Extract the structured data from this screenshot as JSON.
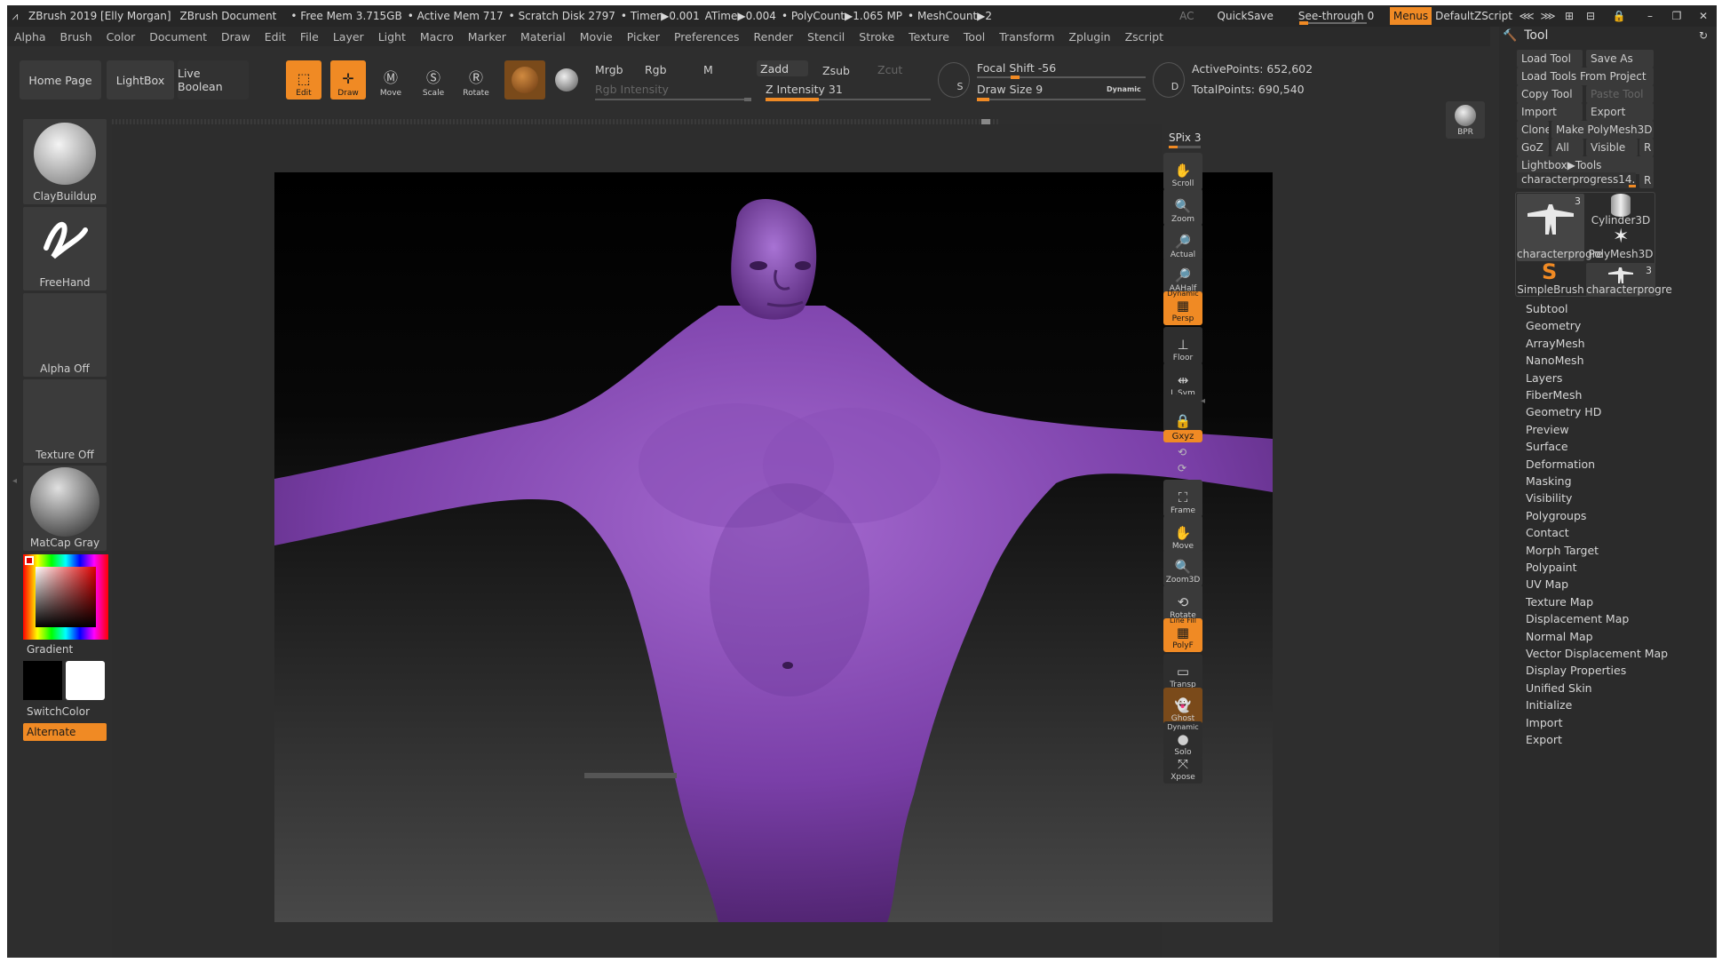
{
  "titlebar": {
    "title": "ZBrush 2019 [Elly Morgan]",
    "doc": "ZBrush Document",
    "free_mem": "• Free Mem 3.715GB",
    "active_mem": "• Active Mem 717",
    "scratch": "• Scratch Disk 2797",
    "timer": "• Timer▶0.001",
    "atime": "ATime▶0.004",
    "polycount": "• PolyCount▶1.065 MP",
    "meshcount": "• MeshCount▶2",
    "ac": "AC",
    "quicksave": "QuickSave",
    "seethrough": "See-through",
    "seethrough_value": "0",
    "menus": "Menus",
    "script": "DefaultZScript"
  },
  "menubar": [
    "Alpha",
    "Brush",
    "Color",
    "Document",
    "Draw",
    "Edit",
    "File",
    "Layer",
    "Light",
    "Macro",
    "Marker",
    "Material",
    "Movie",
    "Picker",
    "Preferences",
    "Render",
    "Stencil",
    "Stroke",
    "Texture",
    "Tool",
    "Transform",
    "Zplugin",
    "Zscript"
  ],
  "toolbar": {
    "home": "Home Page",
    "lightbox": "LightBox",
    "liveboolean": "Live Boolean",
    "edit": "Edit",
    "draw": "Draw",
    "move": "Move",
    "scale": "Scale",
    "rotate": "Rotate",
    "mrgb": "Mrgb",
    "rgb": "Rgb",
    "m": "M",
    "zadd": "Zadd",
    "zsub": "Zsub",
    "zcut": "Zcut",
    "rgb_intensity": "Rgb Intensity",
    "z_intensity": "Z Intensity 31",
    "z_intensity_value": 31,
    "focal_shift": "Focal Shift -56",
    "focal_shift_value": -56,
    "draw_size": "Draw Size 9",
    "draw_size_value": 9,
    "dynamic": "Dynamic",
    "active_points": "ActivePoints: 652,602",
    "total_points": "TotalPoints: 690,540",
    "s_label": "S",
    "d_label": "D"
  },
  "leftshelf": {
    "brush": "ClayBuildup",
    "stroke": "FreeHand",
    "alpha": "Alpha Off",
    "texture": "Texture Off",
    "material": "MatCap Gray",
    "gradient": "Gradient",
    "switchcolor": "SwitchColor",
    "alternate": "Alternate"
  },
  "rightshelf": {
    "bpr": "BPR",
    "spix": "SPix 3",
    "scroll": "Scroll",
    "zoom": "Zoom",
    "actual": "Actual",
    "aahalf": "AAHalf",
    "dynamic": "Dynamic",
    "persp": "Persp",
    "floor": "Floor",
    "lsym": "L.Sym",
    "xyz": "Gxyz",
    "frame": "Frame",
    "move": "Move",
    "zoom3d": "Zoom3D",
    "rotate": "Rotate",
    "linefill": "Line Fill",
    "polyf": "PolyF",
    "transp": "Transp",
    "ghost": "Ghost",
    "dynamic2": "Dynamic",
    "solo": "Solo",
    "xpose": "Xpose"
  },
  "toolpanel": {
    "title": "Tool",
    "load_tool": "Load Tool",
    "save_as": "Save As",
    "load_from_project": "Load Tools From Project",
    "copy_tool": "Copy Tool",
    "paste_tool": "Paste Tool",
    "import": "Import",
    "export": "Export",
    "clone": "Clone",
    "make_polymesh": "Make PolyMesh3D",
    "goz": "GoZ",
    "all": "All",
    "visible": "Visible",
    "r": "R",
    "lightbox_tools": "Lightbox▶Tools",
    "current_tool": "characterprogress14. 48",
    "thumbs": [
      {
        "name": "characterprogre",
        "count": "3"
      },
      {
        "name": "Cylinder3D",
        "count": ""
      },
      {
        "name": "PolyMesh3D",
        "count": ""
      },
      {
        "name": "SimpleBrush",
        "count": ""
      },
      {
        "name": "characterprogre",
        "count": "3"
      }
    ],
    "items": [
      "Subtool",
      "Geometry",
      "ArrayMesh",
      "NanoMesh",
      "Layers",
      "FiberMesh",
      "Geometry HD",
      "Preview",
      "Surface",
      "Deformation",
      "Masking",
      "Visibility",
      "Polygroups",
      "Contact",
      "Morph Target",
      "Polypaint",
      "UV Map",
      "Texture Map",
      "Displacement Map",
      "Normal Map",
      "Vector Displacement Map",
      "Display Properties",
      "Unified Skin",
      "Initialize",
      "Import",
      "Export"
    ]
  },
  "colors": {
    "accent": "#f08a24",
    "mesh": "#8a4bb0",
    "background": "#2e2e2e"
  }
}
